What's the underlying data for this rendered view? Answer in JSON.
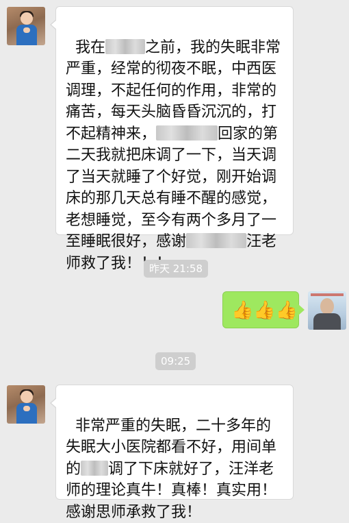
{
  "messages": [
    {
      "parts": [
        "我在",
        "之前，我的失眠非常严重，经常的彻夜不眠，中西医调理，不起任何的作用，非常的痛苦，每天头脑昏昏沉沉的，打不起精神来，",
        "回家的第二天我就把床调了一下，当天调了当天就睡了个好觉，刚开始调床的那几天总有睡不醒的感觉，老想睡觉，至今有两个多月了一至睡眠很好，感谢",
        "汪老师救了我！！！"
      ]
    },
    {
      "time": "昨天 21:58",
      "emoji": "👍👍👍",
      "emoji_name": "thumbs-up-icon"
    },
    {
      "time": "09:25",
      "parts": [
        "非常严重的失眠，二十多年的失眠大小医院都看不好，用间单的",
        "调了下床就好了，汪洋老师的理论真牛！真棒！真实用！感谢思师承救了我！"
      ]
    }
  ],
  "colors": {
    "background": "#ebebeb",
    "bubble": "#ffffff",
    "sent_bubble": "#9ee85f",
    "time_pill": "#cecece"
  }
}
